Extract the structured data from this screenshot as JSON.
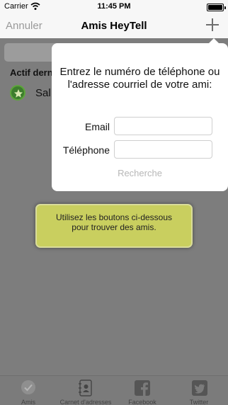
{
  "status_bar": {
    "carrier": "Carrier",
    "time": "11:45 PM"
  },
  "nav": {
    "cancel_label": "Annuler",
    "title": "Amis HeyTell",
    "add_icon": "plus-icon"
  },
  "background": {
    "section_header": "Actif derni",
    "friend_name": "Sal"
  },
  "popover": {
    "prompt": "Entrez le numéro de téléphone ou l'adresse courriel de votre ami:",
    "email_label": "Email",
    "email_value": "",
    "phone_label": "Téléphone",
    "phone_value": "",
    "search_label": "Recherche"
  },
  "hint": {
    "text": "Utilisez les boutons ci-dessous pour trouver des amis."
  },
  "tabs": [
    {
      "label": "Amis",
      "icon": "check-circle-icon"
    },
    {
      "label": "Carnet d'adresses",
      "icon": "address-book-icon"
    },
    {
      "label": "Facebook",
      "icon": "facebook-icon"
    },
    {
      "label": "Twitter",
      "icon": "twitter-icon"
    }
  ],
  "colors": {
    "hint_background": "#c9cf5f",
    "avatar_green": "#3d7d2d",
    "dim_background": "#7d7d7d"
  }
}
